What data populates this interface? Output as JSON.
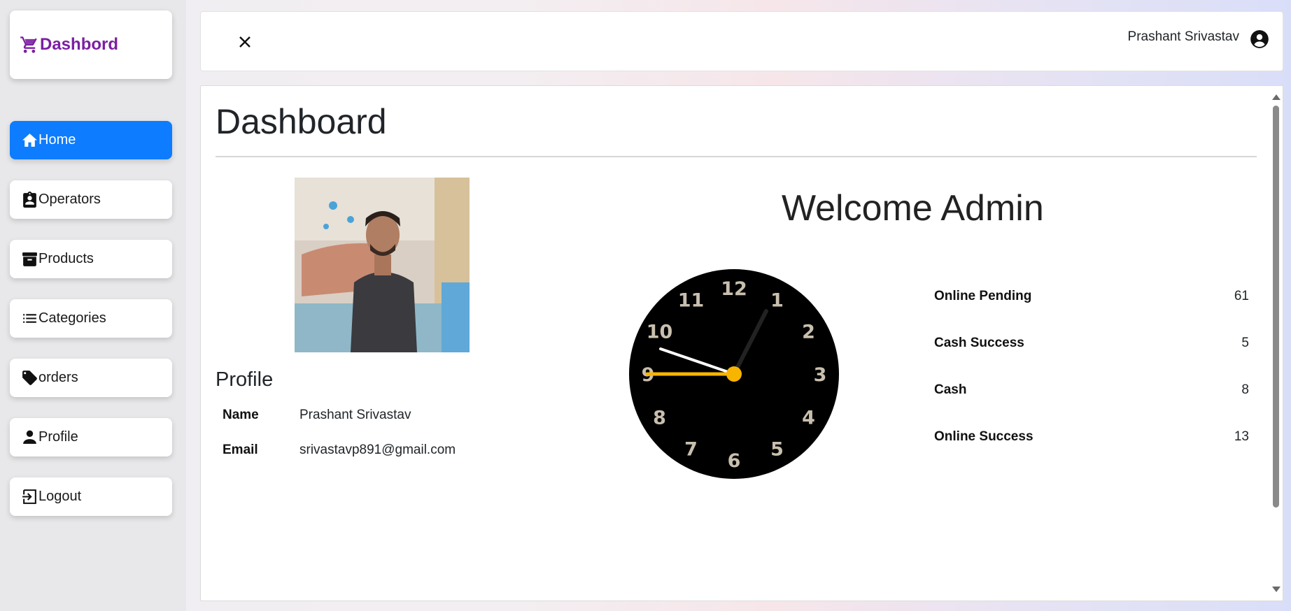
{
  "brand": {
    "label": "Dashbord",
    "icon": "cart-icon",
    "color": "#7b1fa2"
  },
  "sidebar": {
    "items": [
      {
        "label": "Home",
        "icon": "home-icon",
        "active": true
      },
      {
        "label": "Operators",
        "icon": "id-badge-icon",
        "active": false
      },
      {
        "label": "Products",
        "icon": "archive-icon",
        "active": false
      },
      {
        "label": "Categories",
        "icon": "list-icon",
        "active": false
      },
      {
        "label": "orders",
        "icon": "tag-icon",
        "active": false
      },
      {
        "label": "Profile",
        "icon": "person-icon",
        "active": false
      },
      {
        "label": "Logout",
        "icon": "logout-icon",
        "active": false
      }
    ],
    "active_color": "#0d7cff"
  },
  "topbar": {
    "close_icon": "close-icon",
    "user_name": "Prashant Srivastav",
    "user_icon": "user-circle-icon"
  },
  "main": {
    "title": "Dashboard",
    "welcome": "Welcome Admin",
    "profile": {
      "heading": "Profile",
      "rows": [
        {
          "key": "Name",
          "value": "Prashant Srivastav"
        },
        {
          "key": "Email",
          "value": "srivastavp891@gmail.com"
        }
      ]
    },
    "clock": {
      "numbers": [
        "12",
        "1",
        "2",
        "3",
        "4",
        "5",
        "6",
        "7",
        "8",
        "9",
        "10",
        "11"
      ],
      "hour_hand_color": "#ffffff",
      "minute_hand_color": "#222222",
      "second_hand_color": "#f7b500",
      "face_color": "#000000",
      "number_color": "#c9bfae"
    },
    "stats": [
      {
        "label": "Online Pending",
        "value": "61"
      },
      {
        "label": "Cash Success",
        "value": "5"
      },
      {
        "label": "Cash",
        "value": "8"
      },
      {
        "label": "Online Success",
        "value": "13"
      }
    ]
  }
}
